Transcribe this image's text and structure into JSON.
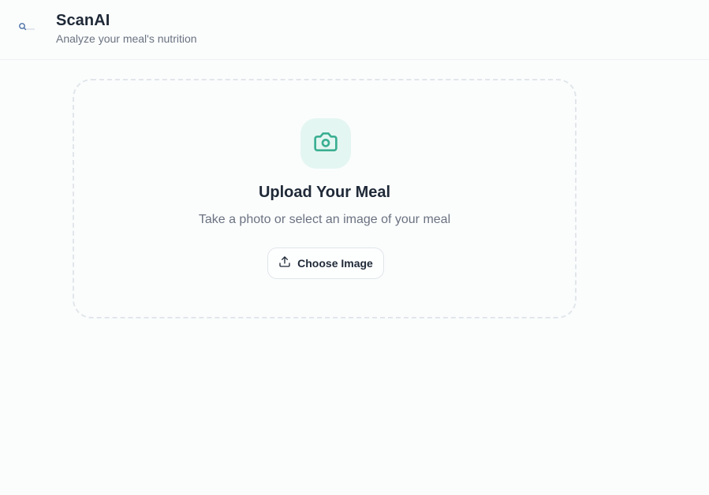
{
  "header": {
    "title": "ScanAI",
    "subtitle": "Analyze your meal's nutrition",
    "logo_icon": "scan-logo-icon"
  },
  "upload": {
    "icon": "camera-icon",
    "title": "Upload Your Meal",
    "description": "Take a photo or select an image of your meal",
    "button_label": "Choose Image",
    "button_icon": "upload-icon"
  },
  "colors": {
    "accent": "#3aaf92",
    "accent_bg": "#e4f6f1",
    "text_primary": "#1f2937",
    "text_muted": "#6b7280",
    "border": "#e2e6ea",
    "background": "#fbfdfd"
  }
}
